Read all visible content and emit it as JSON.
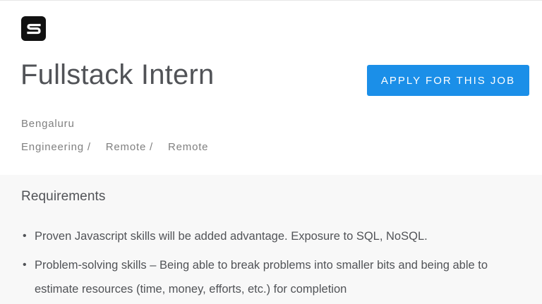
{
  "logo": {
    "letter": "S"
  },
  "job": {
    "title": "Fullstack Intern",
    "apply_label": "APPLY FOR THIS JOB",
    "location": "Bengaluru",
    "categories": [
      "Engineering /",
      "Remote /",
      "Remote"
    ]
  },
  "requirements": {
    "heading": "Requirements",
    "items": [
      "Proven Javascript skills will be added advantage. Exposure to SQL, NoSQL.",
      "Problem-solving skills – Being able to break problems into smaller bits and being able to estimate resources (time, money, efforts, etc.) for completion"
    ]
  },
  "colors": {
    "accent": "#1b8fe8",
    "title_text": "#515357",
    "meta_text": "#808080",
    "section_bg": "#f8f8f8"
  }
}
